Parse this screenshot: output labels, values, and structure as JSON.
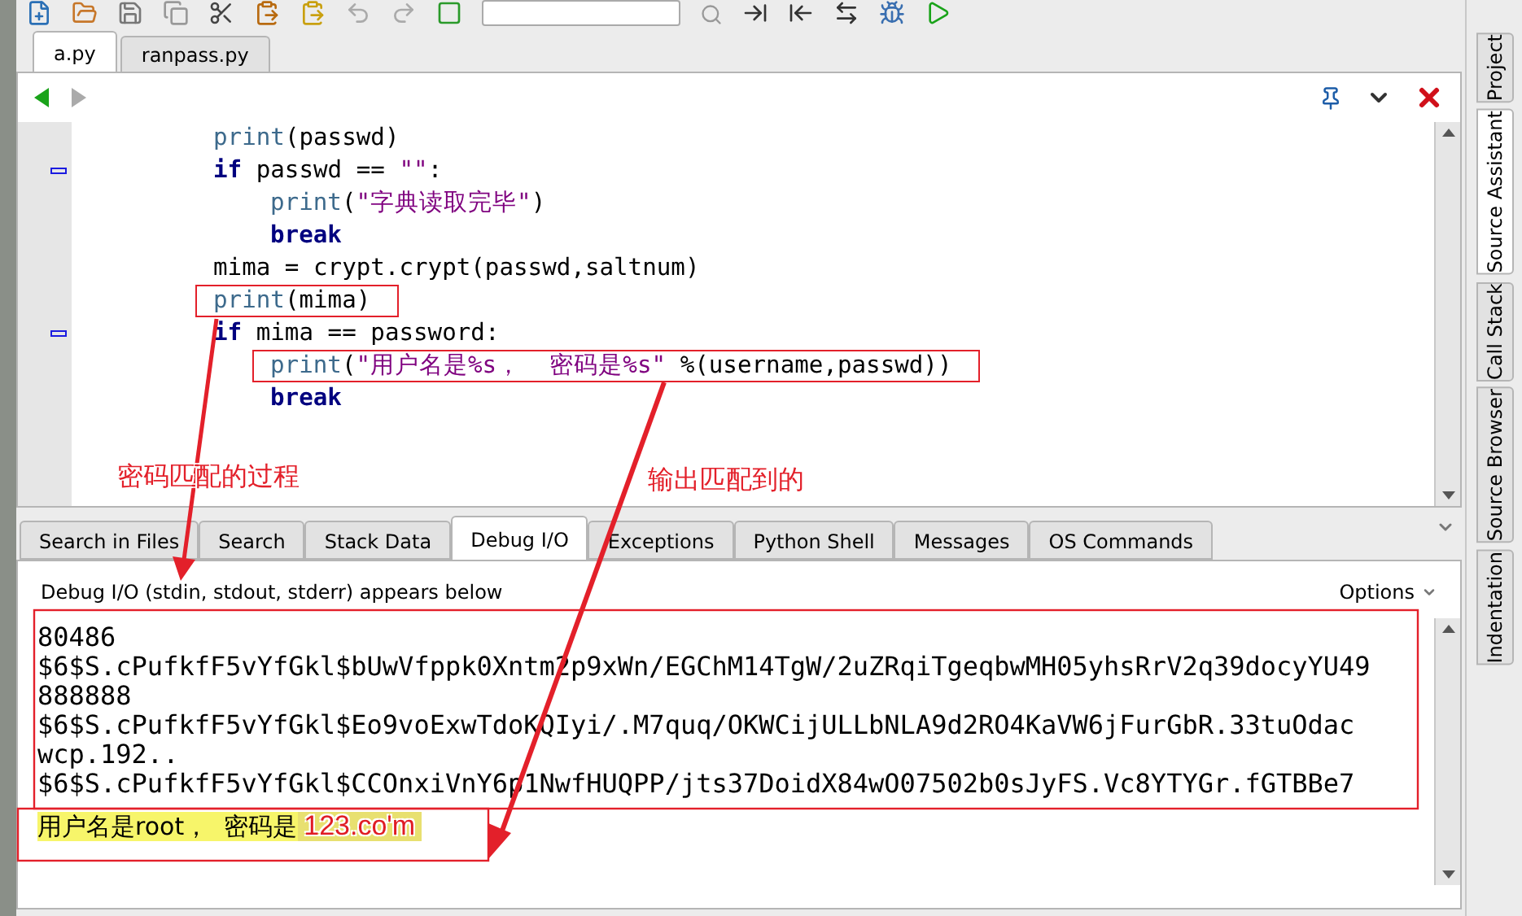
{
  "editor_tabs": [
    {
      "label": "a.py",
      "selected": true
    },
    {
      "label": "ranpass.py",
      "selected": false
    }
  ],
  "code_lines": [
    {
      "tokens": [
        {
          "kind": "builtin",
          "text": "print"
        },
        {
          "kind": "plain",
          "text": "(passwd)"
        }
      ]
    },
    {
      "tokens": [
        {
          "kind": "keyword",
          "text": "if"
        },
        {
          "kind": "plain",
          "text": " passwd == "
        },
        {
          "kind": "string",
          "text": "\"\""
        },
        {
          "kind": "plain",
          "text": ":"
        }
      ],
      "children": [
        {
          "tokens": [
            {
              "kind": "builtin",
              "text": "print"
            },
            {
              "kind": "plain",
              "text": "("
            },
            {
              "kind": "string",
              "text": "\"字典读取完毕\""
            },
            {
              "kind": "plain",
              "text": ")"
            }
          ]
        },
        {
          "tokens": [
            {
              "kind": "keyword",
              "text": "break"
            }
          ]
        }
      ]
    },
    {
      "tokens": [
        {
          "kind": "plain",
          "text": "mima = crypt.crypt(passwd,saltnum)"
        }
      ]
    },
    {
      "boxed": true,
      "tokens": [
        {
          "kind": "builtin",
          "text": "print"
        },
        {
          "kind": "plain",
          "text": "(mima)"
        }
      ]
    },
    {
      "tokens": [
        {
          "kind": "keyword",
          "text": "if"
        },
        {
          "kind": "plain",
          "text": " mima == password:"
        }
      ],
      "children": [
        {
          "boxed": true,
          "tokens": [
            {
              "kind": "builtin",
              "text": "print"
            },
            {
              "kind": "plain",
              "text": "("
            },
            {
              "kind": "string",
              "text": "\"用户名是%s，  密码是%s\""
            },
            {
              "kind": "plain",
              "text": " %(username,passwd))"
            }
          ]
        },
        {
          "tokens": [
            {
              "kind": "keyword",
              "text": "break"
            }
          ]
        }
      ]
    }
  ],
  "bottom_tabs": [
    {
      "label": "Search in Files",
      "selected": false
    },
    {
      "label": "Search",
      "selected": false
    },
    {
      "label": "Stack Data",
      "selected": false
    },
    {
      "label": "Debug I/O",
      "selected": true
    },
    {
      "label": "Exceptions",
      "selected": false
    },
    {
      "label": "Python Shell",
      "selected": false
    },
    {
      "label": "Messages",
      "selected": false
    },
    {
      "label": "OS Commands",
      "selected": false
    }
  ],
  "debug_io": {
    "caption": "Debug I/O (stdin, stdout, stderr) appears below",
    "options": "Options",
    "output_lines": [
      "80486",
      "$6$S.cPufkfF5vYfGkl$bUwVfppk0Xntm2p9xWn/EGChM14TgW/2uZRqiTgeqbwMH05yhsRrV2q39docyYU49",
      "888888",
      "$6$S.cPufkfF5vYfGkl$Eo9voExwTdoKQIyi/.M7quq/OKWCijULLbNLA9d2RO4KaVW6jFurGbR.33tuOdac",
      "wcp.192..",
      "$6$S.cPufkfF5vYfGkl$CCOnxiVnY6p1NwfHUQPP/jts37DoidX84wO07502b0sJyFS.Vc8YTYGr.fGTBBe7"
    ],
    "result": {
      "text": "用户名是root，  密码是",
      "password": "123.co'm"
    }
  },
  "side_tabs": [
    {
      "label": "Project",
      "selected": false
    },
    {
      "label": "Source Assistant",
      "selected": true
    },
    {
      "label": "Call Stack",
      "selected": false
    },
    {
      "label": "Source Browser",
      "selected": false
    },
    {
      "label": "Indentation",
      "selected": false
    }
  ],
  "annotations": [
    {
      "text": "密码匹配的过程"
    },
    {
      "text": "输出匹配到的"
    }
  ]
}
